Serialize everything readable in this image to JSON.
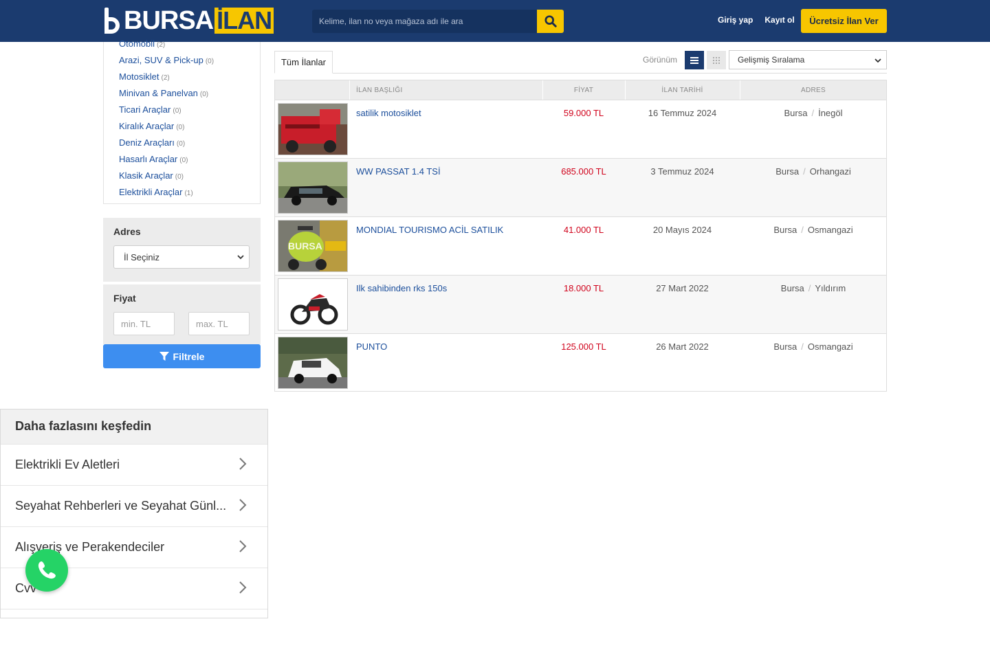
{
  "header": {
    "logo_text": "BURSA",
    "logo_accent": "İLAN",
    "search_placeholder": "Kelime, ilan no veya mağaza adı ile ara",
    "login": "Giriş yap",
    "register": "Kayıt ol",
    "post_ad": "Ücretsiz İlan Ver"
  },
  "categories": [
    {
      "label": "Otomobil",
      "count": "(2)"
    },
    {
      "label": "Arazi, SUV & Pick-up",
      "count": "(0)"
    },
    {
      "label": "Motosiklet",
      "count": "(2)"
    },
    {
      "label": "Minivan & Panelvan",
      "count": "(0)"
    },
    {
      "label": "Ticari Araçlar",
      "count": "(0)"
    },
    {
      "label": "Kiralık Araçlar",
      "count": "(0)"
    },
    {
      "label": "Deniz Araçları",
      "count": "(0)"
    },
    {
      "label": "Hasarlı Araçlar",
      "count": "(0)"
    },
    {
      "label": "Klasik Araçlar",
      "count": "(0)"
    },
    {
      "label": "Elektrikli Araçlar",
      "count": "(1)"
    }
  ],
  "filters": {
    "address_title": "Adres",
    "city_select": "İl Seçiniz",
    "price_title": "Fiyat",
    "min_placeholder": "min. TL",
    "max_placeholder": "max. TL",
    "filter_button": "Filtrele"
  },
  "listing": {
    "tab_all": "Tüm İlanlar",
    "view_label": "Görünüm",
    "sort_select": "Gelişmiş Sıralama",
    "columns": [
      "İLAN BAŞLIĞI",
      "FİYAT",
      "İLAN TARİHİ",
      "ADRES"
    ],
    "rows": [
      {
        "title": "satilik motosiklet",
        "price": "59.000 TL",
        "date": "16 Temmuz 2024",
        "city": "Bursa",
        "district": "İnegöl"
      },
      {
        "title": "WW PASSAT 1.4 TSİ",
        "price": "685.000 TL",
        "date": "3 Temmuz 2024",
        "city": "Bursa",
        "district": "Orhangazi"
      },
      {
        "title": "MONDIAL TOURISMO ACİL SATILIK",
        "price": "41.000 TL",
        "date": "20 Mayıs 2024",
        "city": "Bursa",
        "district": "Osmangazi"
      },
      {
        "title": "Ilk sahibinden rks 150s",
        "price": "18.000 TL",
        "date": "27 Mart 2022",
        "city": "Bursa",
        "district": "Yıldırım"
      },
      {
        "title": "PUNTO",
        "price": "125.000 TL",
        "date": "26 Mart 2022",
        "city": "Bursa",
        "district": "Osmangazi"
      }
    ]
  },
  "explore": {
    "title": "Daha fazlasını keşfedin",
    "items": [
      "Elektrikli Ev Aletleri",
      "Seyahat Rehberleri ve Seyahat Günl...",
      "Alışveriş ve Perakendeciler",
      "Cvv"
    ]
  },
  "colors": {
    "brand_navy": "#1b3b6f",
    "brand_yellow": "#f7c600",
    "price_red": "#d0021b",
    "filter_blue": "#3d8ef0",
    "whatsapp_green": "#25d366"
  }
}
